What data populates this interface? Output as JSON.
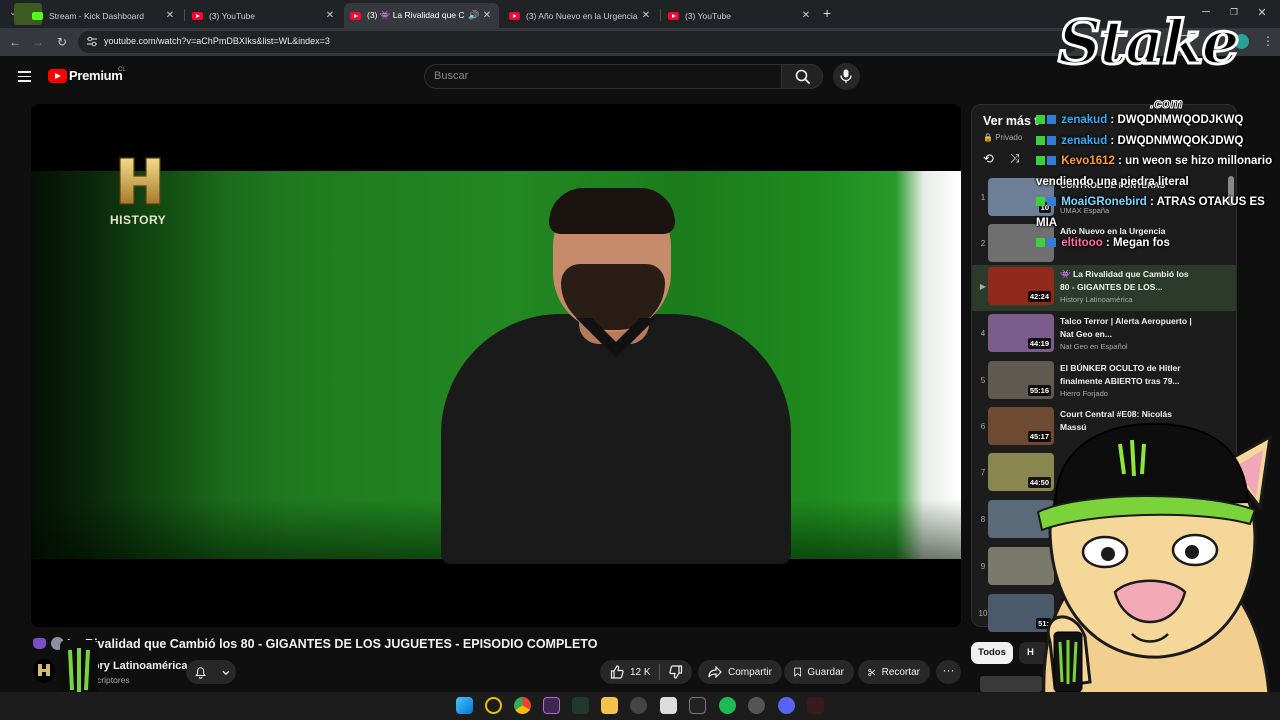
{
  "browser": {
    "tabs": [
      {
        "title": "Stream - Kick Dashboard",
        "type": "kick",
        "active": false
      },
      {
        "title": "(3) YouTube",
        "type": "youtube",
        "active": false
      },
      {
        "title": "(3) 👾 La Rivalidad que C",
        "type": "youtube",
        "active": true
      },
      {
        "title": "(3) Año Nuevo en la Urgencia",
        "type": "youtube",
        "active": false
      },
      {
        "title": "(3) YouTube",
        "type": "youtube",
        "active": false
      }
    ],
    "new_tab": "+",
    "url": "youtube.com/watch?v=aChPmDBXIks&list=WL&index=3"
  },
  "youtube": {
    "brand": "Premium",
    "country": "CL",
    "search_placeholder": "Buscar",
    "video": {
      "title": "La Rivalidad que Cambió los 80 - GIGANTES DE LOS JUGUETES - EPISODIO COMPLETO",
      "watermark": "HISTORY"
    },
    "channel": {
      "name": "History Latinoamérica",
      "subscribers": "de suscriptores"
    },
    "actions": {
      "likes": "12 K",
      "share": "Compartir",
      "save": "Guardar",
      "clip": "Recortar"
    },
    "playlist": {
      "title": "Ver más t",
      "privacy": "Privado",
      "items": [
        {
          "index": "1",
          "title": "CONTROL DE FONTERAS",
          "channel": "UMAX España",
          "duration": "10",
          "active": false,
          "thumb": "#6d7f96"
        },
        {
          "index": "2",
          "title": "Año Nuevo en la Urgencia",
          "channel": "",
          "duration": "",
          "active": false,
          "thumb": "#6f6f6f"
        },
        {
          "index": "▶",
          "title": "👾 La Rivalidad que Cambió los 80 - GIGANTES DE LOS...",
          "channel": "History Latinoamérica",
          "duration": "42:24",
          "active": true,
          "thumb": "#8f2a1a"
        },
        {
          "index": "4",
          "title": "Talco Terror | Alerta Aeropuerto | Nat Geo en...",
          "channel": "Nat Geo en Español",
          "duration": "44:19",
          "active": false,
          "thumb": "#7a5d8a"
        },
        {
          "index": "5",
          "title": "El BÚNKER OCULTO de Hitler finalmente ABIERTO tras 79...",
          "channel": "Hierro Forjado",
          "duration": "55:16",
          "active": false,
          "thumb": "#5e5a50"
        },
        {
          "index": "6",
          "title": "Court Central #E08: Nicolás Massú",
          "channel": "",
          "duration": "45:17",
          "active": false,
          "thumb": "#6e4a32"
        },
        {
          "index": "7",
          "title": "",
          "channel": "",
          "duration": "44:50",
          "active": false,
          "thumb": "#8a8650"
        },
        {
          "index": "8",
          "title": "",
          "channel": "",
          "duration": "",
          "active": false,
          "thumb": "#5a6a78"
        },
        {
          "index": "9",
          "title": "",
          "channel": "",
          "duration": "",
          "active": false,
          "thumb": "#7a7a6a"
        },
        {
          "index": "10",
          "title": "",
          "channel": "",
          "duration": "51:",
          "active": false,
          "thumb": "#4a5a6a"
        }
      ]
    },
    "chips": {
      "all": "Todos",
      "second": "H"
    }
  },
  "chat": [
    {
      "user": "zenakud",
      "message": "DWQDNMWQODJKWQ",
      "color": "u-blue"
    },
    {
      "user": "zenakud",
      "message": "DWQDNMWQOKJDWQ",
      "color": "u-blue"
    },
    {
      "user": "Kevo1612",
      "message": "un weon se hizo millonario vendiendo una piedra literal",
      "color": "u-orange"
    },
    {
      "user": "MoaiGRonebird",
      "message": "ATRAS OTAKUS ES MIA",
      "color": "u-cyan"
    },
    {
      "user": "eltitooo",
      "message": "Megan fos",
      "color": "u-pink"
    }
  ],
  "overlay": {
    "sponsor": "Stake",
    "sponsor_tld": ".com"
  },
  "colors": {
    "accent": "#ff0000",
    "kick": "#53fc18",
    "bg": "#0f0f0f"
  }
}
